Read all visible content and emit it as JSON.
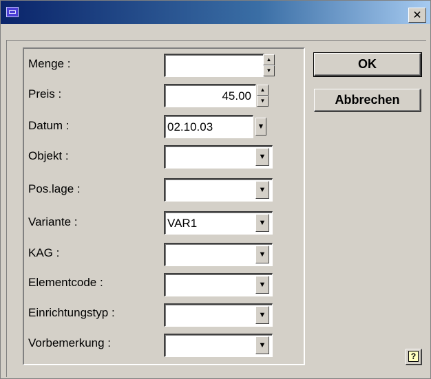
{
  "titlebar": {
    "close_symbol": "✕"
  },
  "buttons": {
    "ok_label": "OK",
    "cancel_label": "Abbrechen"
  },
  "fields": {
    "menge": {
      "label": "Menge :",
      "value": ""
    },
    "preis": {
      "label": "Preis :",
      "value": "45.00"
    },
    "datum": {
      "label": "Datum :",
      "value": "02.10.03"
    },
    "objekt": {
      "label": "Objekt :",
      "value": ""
    },
    "poslage": {
      "label": "Pos.lage :",
      "value": ""
    },
    "variante": {
      "label": "Variante :",
      "value": "VAR1"
    },
    "kag": {
      "label": "KAG :",
      "value": ""
    },
    "elementcode": {
      "label": "Elementcode :",
      "value": ""
    },
    "einrichtungstyp": {
      "label": "Einrichtungstyp :",
      "value": ""
    },
    "vorbemerkung": {
      "label": "Vorbemerkung :",
      "value": ""
    }
  },
  "help": {
    "symbol": "?"
  },
  "colors": {
    "face": "#d4d0c8",
    "titlebar_start": "#0a246a",
    "titlebar_end": "#a6caf0"
  }
}
